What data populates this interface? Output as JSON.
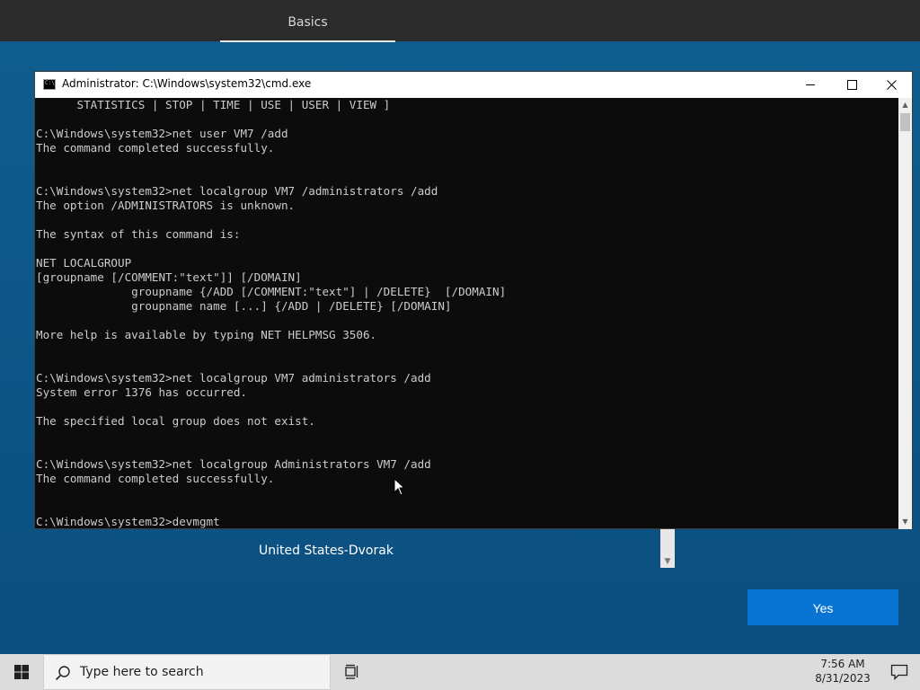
{
  "oobe": {
    "tab_label": "Basics",
    "layout_option": "United States-Dvorak",
    "yes_label": "Yes"
  },
  "cmd_window": {
    "title": "Administrator: C:\\Windows\\system32\\cmd.exe",
    "icon_text": "C:\\",
    "lines": [
      "      STATISTICS | STOP | TIME | USE | USER | VIEW ]",
      "",
      "C:\\Windows\\system32>net user VM7 /add",
      "The command completed successfully.",
      "",
      "",
      "C:\\Windows\\system32>net localgroup VM7 /administrators /add",
      "The option /ADMINISTRATORS is unknown.",
      "",
      "The syntax of this command is:",
      "",
      "NET LOCALGROUP",
      "[groupname [/COMMENT:\"text\"]] [/DOMAIN]",
      "              groupname {/ADD [/COMMENT:\"text\"] | /DELETE}  [/DOMAIN]",
      "              groupname name [...] {/ADD | /DELETE} [/DOMAIN]",
      "",
      "More help is available by typing NET HELPMSG 3506.",
      "",
      "",
      "C:\\Windows\\system32>net localgroup VM7 administrators /add",
      "System error 1376 has occurred.",
      "",
      "The specified local group does not exist.",
      "",
      "",
      "C:\\Windows\\system32>net localgroup Administrators VM7 /add",
      "The command completed successfully.",
      "",
      "",
      "C:\\Windows\\system32>devmgmt"
    ]
  },
  "taskbar": {
    "search_placeholder": "Type here to search",
    "time": "7:56 AM",
    "date": "8/31/2023"
  }
}
